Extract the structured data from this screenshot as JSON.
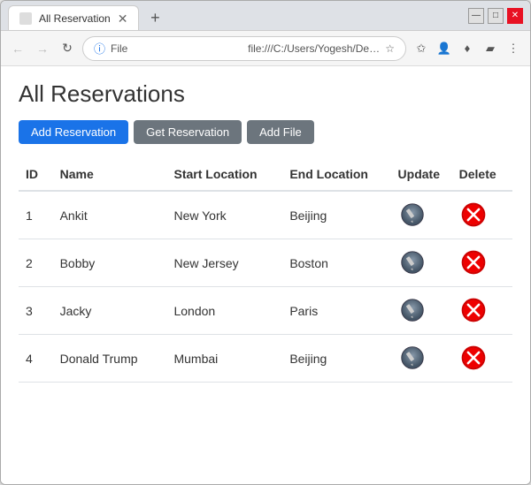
{
  "window": {
    "tab_title": "All Reservation",
    "url": "file:///C:/Users/Yogesh/Desktop/jQuer...",
    "url_prefix": "File"
  },
  "page": {
    "title": "All Reservations",
    "buttons": {
      "add": "Add Reservation",
      "get": "Get Reservation",
      "file": "Add File"
    }
  },
  "table": {
    "headers": {
      "id": "ID",
      "name": "Name",
      "start_location": "Start Location",
      "end_location": "End Location",
      "update": "Update",
      "delete": "Delete"
    },
    "rows": [
      {
        "id": "1",
        "name": "Ankit",
        "start": "New York",
        "end": "Beijing"
      },
      {
        "id": "2",
        "name": "Bobby",
        "start": "New Jersey",
        "end": "Boston"
      },
      {
        "id": "3",
        "name": "Jacky",
        "start": "London",
        "end": "Paris"
      },
      {
        "id": "4",
        "name": "Donald Trump",
        "start": "Mumbai",
        "end": "Beijing"
      }
    ]
  }
}
